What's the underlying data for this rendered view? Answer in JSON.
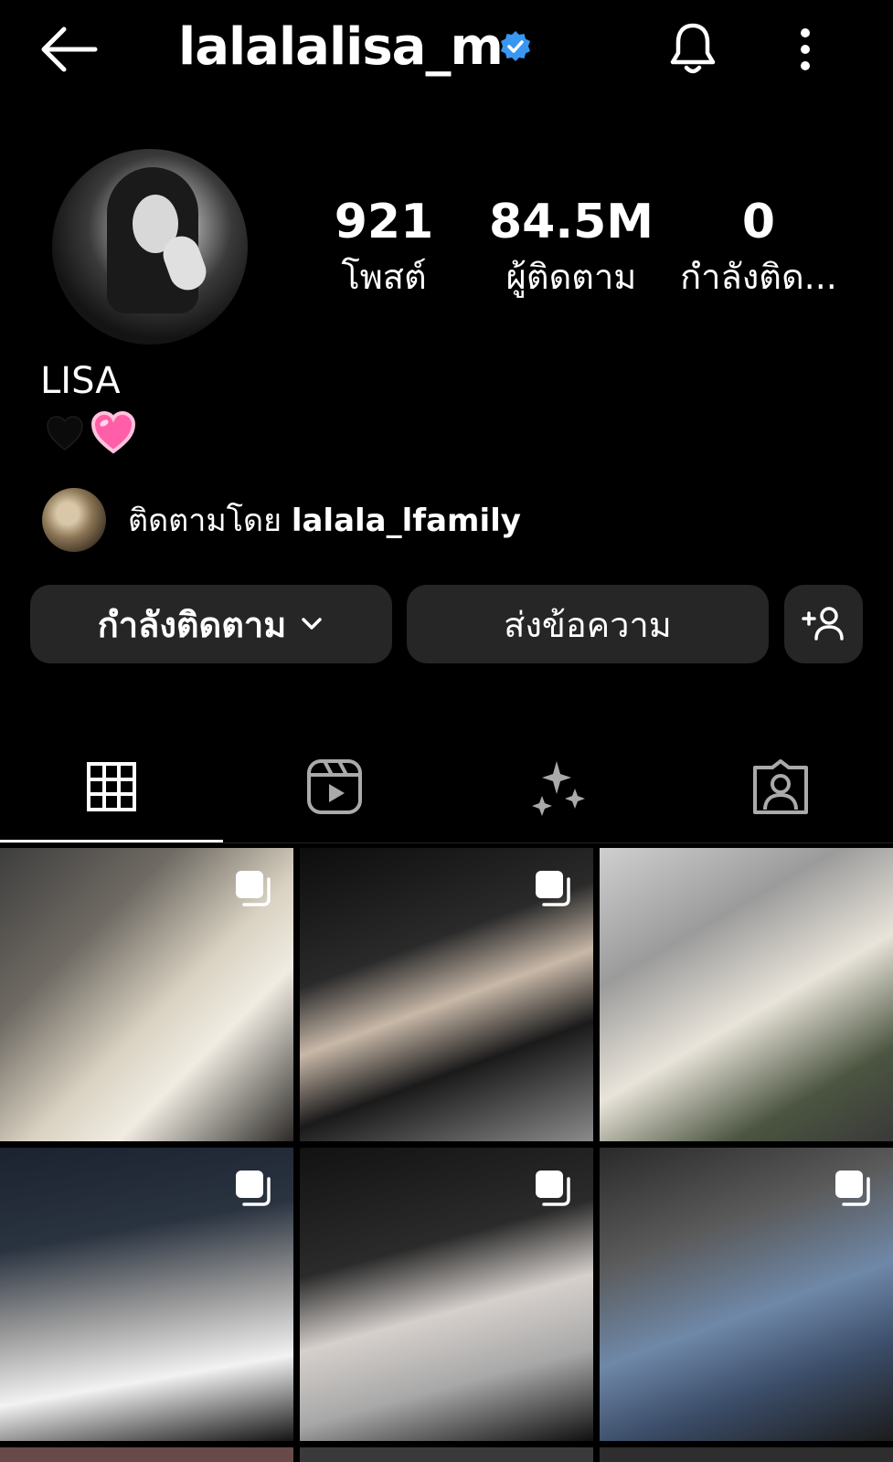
{
  "header": {
    "username": "lalalalisa_m"
  },
  "stats": [
    {
      "value": "921",
      "label": "โพสต์"
    },
    {
      "value": "84.5M",
      "label": "ผู้ติดตาม"
    },
    {
      "value": "0",
      "label": "กำลังติด..."
    }
  ],
  "profile": {
    "display_name": "LISA"
  },
  "followed_by": {
    "prefix": "ติดตามโดย",
    "username": "lalala_lfamily"
  },
  "buttons": {
    "following": "กำลังติดตาม",
    "message": "ส่งข้อความ"
  },
  "tabs": [
    "grid-icon",
    "reels-icon",
    "sparkle-icon",
    "tagged-icon"
  ],
  "colors": {
    "verified": "#3897f0",
    "heart_pink": "#ff5fa8",
    "button_bg": "#262626",
    "background": "#000000"
  },
  "posts": [
    {
      "multi": true
    },
    {
      "multi": true
    },
    {
      "multi": false
    },
    {
      "multi": true
    },
    {
      "multi": true
    },
    {
      "multi": true
    }
  ]
}
